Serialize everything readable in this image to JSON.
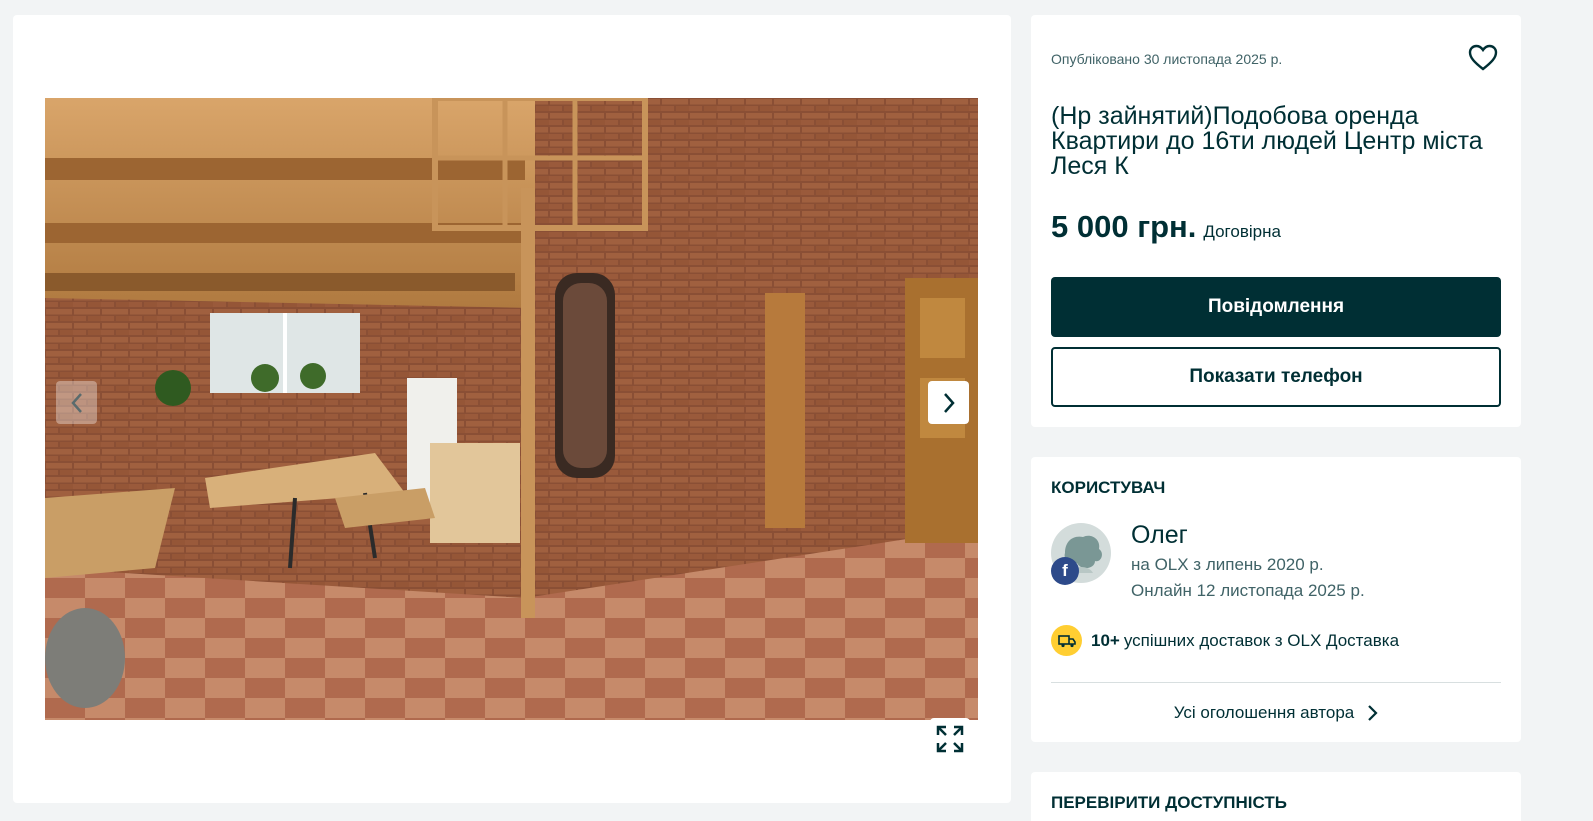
{
  "gallery": {
    "photo_alt": "Apartment interior photo",
    "prev_icon": "chevron-left-icon",
    "next_icon": "chevron-right-icon",
    "fullscreen_icon": "expand-icon"
  },
  "ad": {
    "posted": "Опубліковано 30 листопада 2025 р.",
    "title": "(Нр зайнятий)Подобова оренда Квартири до 16ти людей Центр міста Леся К",
    "price": "5 000 грн.",
    "negotiable": "Договірна",
    "message_button": "Повідомлення",
    "phone_button": "Показати телефон",
    "favorite_icon": "heart-icon"
  },
  "user": {
    "heading": "КОРИСТУВАЧ",
    "name": "Олег",
    "since": "на OLX з липень 2020 р.",
    "online": "Онлайн 12 листопада 2025 р.",
    "facebook_badge": "f",
    "delivery_count": "10+",
    "delivery_text": "успішних доставок з OLX Доставка",
    "all_ads_link": "Усі оголошення автора"
  },
  "availability": {
    "heading": "ПЕРЕВІРИТИ ДОСТУПНІСТЬ"
  },
  "colors": {
    "primary": "#002f34",
    "background": "#f2f4f5",
    "delivery_badge": "#ffce32",
    "facebook": "#2d4a8a"
  }
}
